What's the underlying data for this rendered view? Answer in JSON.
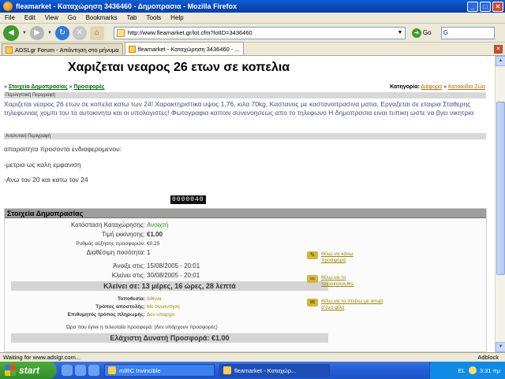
{
  "window": {
    "title": "fleamarket - Καταχώρηση 3436460 - Δημοπρασια - Mozilla Firefox",
    "min": "_",
    "max": "□",
    "close": "✕"
  },
  "menu": [
    "File",
    "Edit",
    "View",
    "Go",
    "Bookmarks",
    "Tab",
    "Tools",
    "Help"
  ],
  "nav": {
    "url": "http://www.fleamarket.gr/lot.cfm?lotID=3436460",
    "go_label": "Go",
    "search_value": "G"
  },
  "tabs": [
    {
      "label": "ADSLgr Forum - Απάντηση στο μήνυμα"
    },
    {
      "label": "fleamarket - Καταχώρηση 3436460 - ..."
    }
  ],
  "page": {
    "heading": "Χαριζεται νεαρος 26 ετων σε κοπελια",
    "crumbs": {
      "prefix1": "»",
      "auction_info": "Στοιχεία Δημοπρασίας",
      "prefix2": "»",
      "offers": "Προσφορές",
      "category_label": "Κατηγορία:",
      "cat1": "Διάφορα",
      "arrow": "»",
      "cat2": "Κατοικίδια Ζώα"
    },
    "short_desc_title": "Περιληπτική Περιγραφή",
    "short_desc": "Χαριζεται νεαρος 26 ετων σε κοπελα κατω των 24! Χαρακτηριστικα υψος 1,76, κιλα 70kg, Καστανος με καστανοπρασινα ματια, Εργαζεται σε εταιρια Σταθερης τηλεφωνιας χομπι του τα αυτοκινητα και οι υπολογιστες! Φωτογραφια καποιν συνενοησεως απο το τηλεφωνο Η δημοπρασια ειναι τυπικη ωστε να βγει νικητρια",
    "long_desc_title": "Αναλυτική Περιγραφή",
    "long_desc": [
      "απαραιτητα προσοντα ενδιαφερομενου:",
      "-μετρια ως καλη εμφανιση",
      "-Ανω τον 20 και κατω τον 24"
    ],
    "counter": "0000040"
  },
  "auction": {
    "header": "Στοιχεία Δημοπρασίας",
    "status_label": "Κατάσταση Καταχώρησης:",
    "status_value": "Ανοιχτή",
    "start_price_label": "Τιμή εκκίνησης:",
    "start_price_value": "€1.00",
    "step_label": "Ρυθμός αύξησης προσφορών:",
    "step_value": "€0.25",
    "qty_label": "Διαθέσιμη ποσότητα:",
    "qty_value": "1",
    "opened_label": "Άνοιξε στις:",
    "opened_value": "15/08/2005 - 20:01",
    "closes_label": "Κλείνει στις:",
    "closes_value": "30/08/2005 - 20:01",
    "closes_in": "Κλείνει σε: 13 μέρες, 16 ώρες, 28 λεπτά",
    "location_label": "Τοποθεσία:",
    "location_value": "Αθηνα",
    "shipping_label": "Τρόπος αποστολής:",
    "shipping_value": "Με συναντηση",
    "payment_label": "Επιθυμητός τρόπος πληρωμής:",
    "payment_value": "Δεν υπαρχει",
    "last_offer": "Ώρα που έγινε η τελευταία προσφορά: (δεν υπάρχουν προσφορές)",
    "min_offer": "Ελάχιστη Δυνατή Προσφορά: €1.00",
    "actions": [
      {
        "icon": "hammer-icon",
        "label": "θέλω να κάνω προσφορά"
      },
      {
        "icon": "binoculars-icon",
        "label": "θέλω να το παρακολουθώ"
      },
      {
        "icon": "email-icon",
        "label": "θέλω να το στείλω με email σ'ένα φίλο"
      }
    ]
  },
  "status_bar": {
    "text": "Waiting for www.adslgr.com...",
    "adblock": "Adblock"
  },
  "taskbar": {
    "start": "start",
    "tasks": [
      {
        "label": "mIRC Invincible"
      },
      {
        "label": "fleamarket - Καταχώρ..."
      }
    ],
    "lang": "EL",
    "clock": "3:31 πμ"
  }
}
